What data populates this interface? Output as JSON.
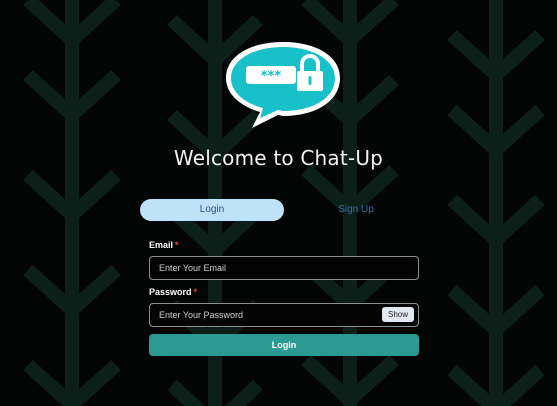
{
  "header": {
    "title": "Welcome to Chat-Up",
    "logo_icon": "chat-bubble-password-lock-icon"
  },
  "tabs": [
    {
      "label": "Login",
      "active": true
    },
    {
      "label": "Sign Up",
      "active": false
    }
  ],
  "form": {
    "email": {
      "label": "Email",
      "required_mark": "*",
      "placeholder": "Enter Your Email",
      "value": ""
    },
    "password": {
      "label": "Password",
      "required_mark": "*",
      "placeholder": "Enter Your Password",
      "value": "",
      "toggle_label": "Show"
    },
    "submit_label": "Login"
  },
  "colors": {
    "background": "#040605",
    "chevron_pattern": "#0c1f19",
    "logo_teal": "#18c0c9",
    "active_tab": "#bee3f8",
    "inactive_tab_text": "#3b6ea5",
    "submit": "#2c9a93",
    "required": "#e53e3e"
  }
}
